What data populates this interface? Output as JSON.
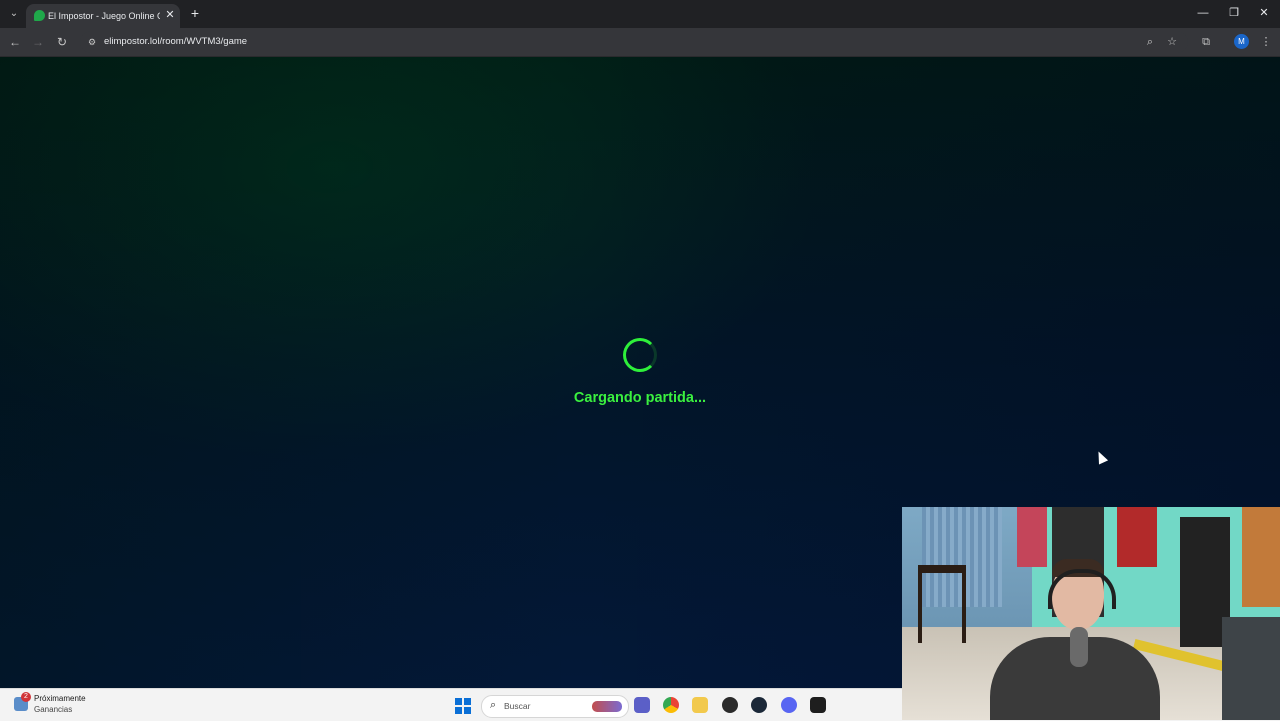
{
  "browser": {
    "tab": {
      "title": "El Impostor - Juego Online Gratis",
      "close_glyph": "✕"
    },
    "new_tab_glyph": "+",
    "window_controls": {
      "minimize": "—",
      "restore": "❐",
      "close": "✕"
    },
    "toolbar": {
      "back": "←",
      "forward": "→",
      "reload": "↻",
      "url": "elimpostor.lol/room/WVTM3/game",
      "zoom": "⌕",
      "bookmark": "☆",
      "extensions": "⧉",
      "profile_initial": "M",
      "menu": "⋮"
    }
  },
  "page": {
    "loading_text": "Cargando partida...",
    "accent_color": "#3af03f"
  },
  "taskbar": {
    "notification_count": "2",
    "widget_title": "Próximamente",
    "widget_subtitle": "Ganancias",
    "search_placeholder": "Buscar",
    "apps": [
      "teams-icon",
      "chrome-icon",
      "file-explorer-icon",
      "app-icon",
      "steam-icon",
      "discord-icon",
      "terminal-icon"
    ]
  }
}
